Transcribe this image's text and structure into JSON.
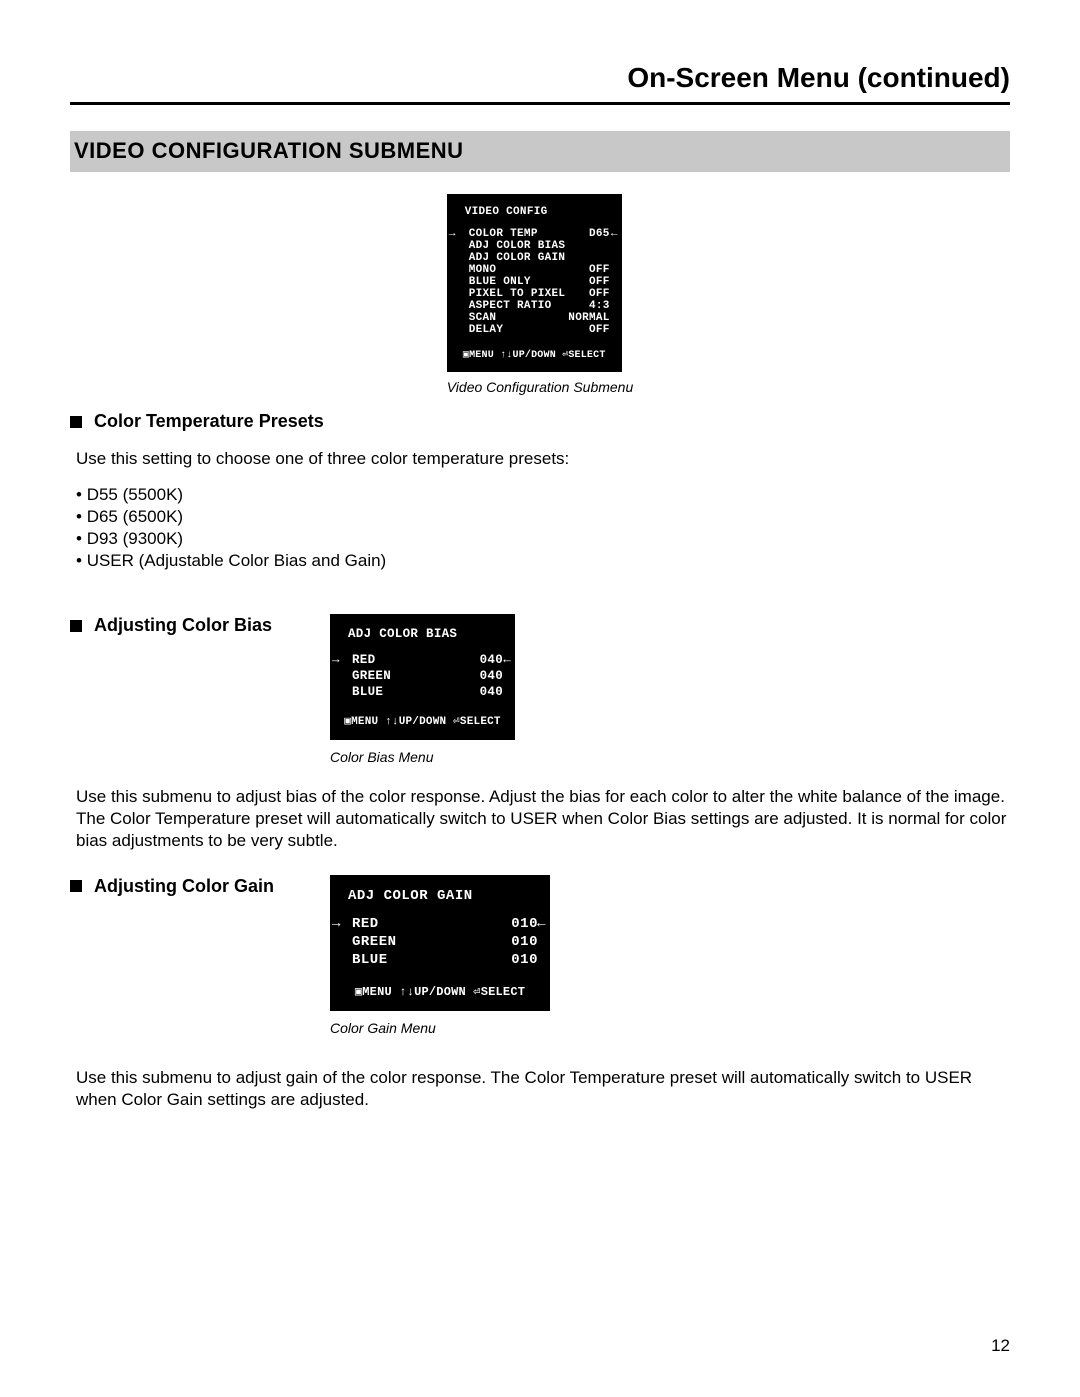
{
  "header": {
    "title": "On-Screen Menu (continued)"
  },
  "banner": {
    "title": "VIDEO CONFIGURATION SUBMENU"
  },
  "osd1": {
    "title": "VIDEO CONFIG",
    "rows": [
      {
        "label": "COLOR TEMP",
        "value": "D65",
        "selected": true
      },
      {
        "label": "ADJ COLOR BIAS",
        "value": ""
      },
      {
        "label": "ADJ COLOR GAIN",
        "value": ""
      },
      {
        "label": "MONO",
        "value": "OFF"
      },
      {
        "label": "BLUE ONLY",
        "value": "OFF"
      },
      {
        "label": "PIXEL TO PIXEL",
        "value": "OFF"
      },
      {
        "label": "ASPECT RATIO",
        "value": "4:3"
      },
      {
        "label": "SCAN",
        "value": "NORMAL"
      },
      {
        "label": "DELAY",
        "value": "OFF"
      }
    ],
    "hint": "▣MENU ↑↓UP/DOWN ⏎SELECT",
    "caption": "Video Configuration Submenu"
  },
  "sec1": {
    "heading": "Color Temperature Presets",
    "intro": "Use this setting to choose one of three color temperature presets:",
    "bullets": [
      "D55 (5500K)",
      "D65 (6500K)",
      "D93 (9300K)",
      "USER (Adjustable Color Bias and Gain)"
    ]
  },
  "sec2": {
    "heading": "Adjusting Color Bias",
    "osd": {
      "title": "ADJ COLOR BIAS",
      "rows": [
        {
          "label": "RED",
          "value": "040",
          "selected": true
        },
        {
          "label": "GREEN",
          "value": "040"
        },
        {
          "label": "BLUE",
          "value": "040"
        }
      ],
      "hint": "▣MENU ↑↓UP/DOWN ⏎SELECT",
      "caption": "Color Bias Menu"
    },
    "body": "Use this submenu to adjust bias of the color response. Adjust the bias for each color to alter the white balance of the image. The Color Temperature preset will automatically switch to USER when Color Bias settings are adjusted. It is normal for color bias adjustments to be very subtle."
  },
  "sec3": {
    "heading": "Adjusting Color Gain",
    "osd": {
      "title": "ADJ COLOR GAIN",
      "rows": [
        {
          "label": "RED",
          "value": "010",
          "selected": true
        },
        {
          "label": "GREEN",
          "value": "010"
        },
        {
          "label": "BLUE",
          "value": "010"
        }
      ],
      "hint": "▣MENU ↑↓UP/DOWN ⏎SELECT",
      "caption": "Color Gain Menu"
    },
    "body": "Use this submenu to adjust gain of the color response. The Color Temperature preset will automatically switch to USER when Color Gain settings are adjusted."
  },
  "page_number": "12"
}
